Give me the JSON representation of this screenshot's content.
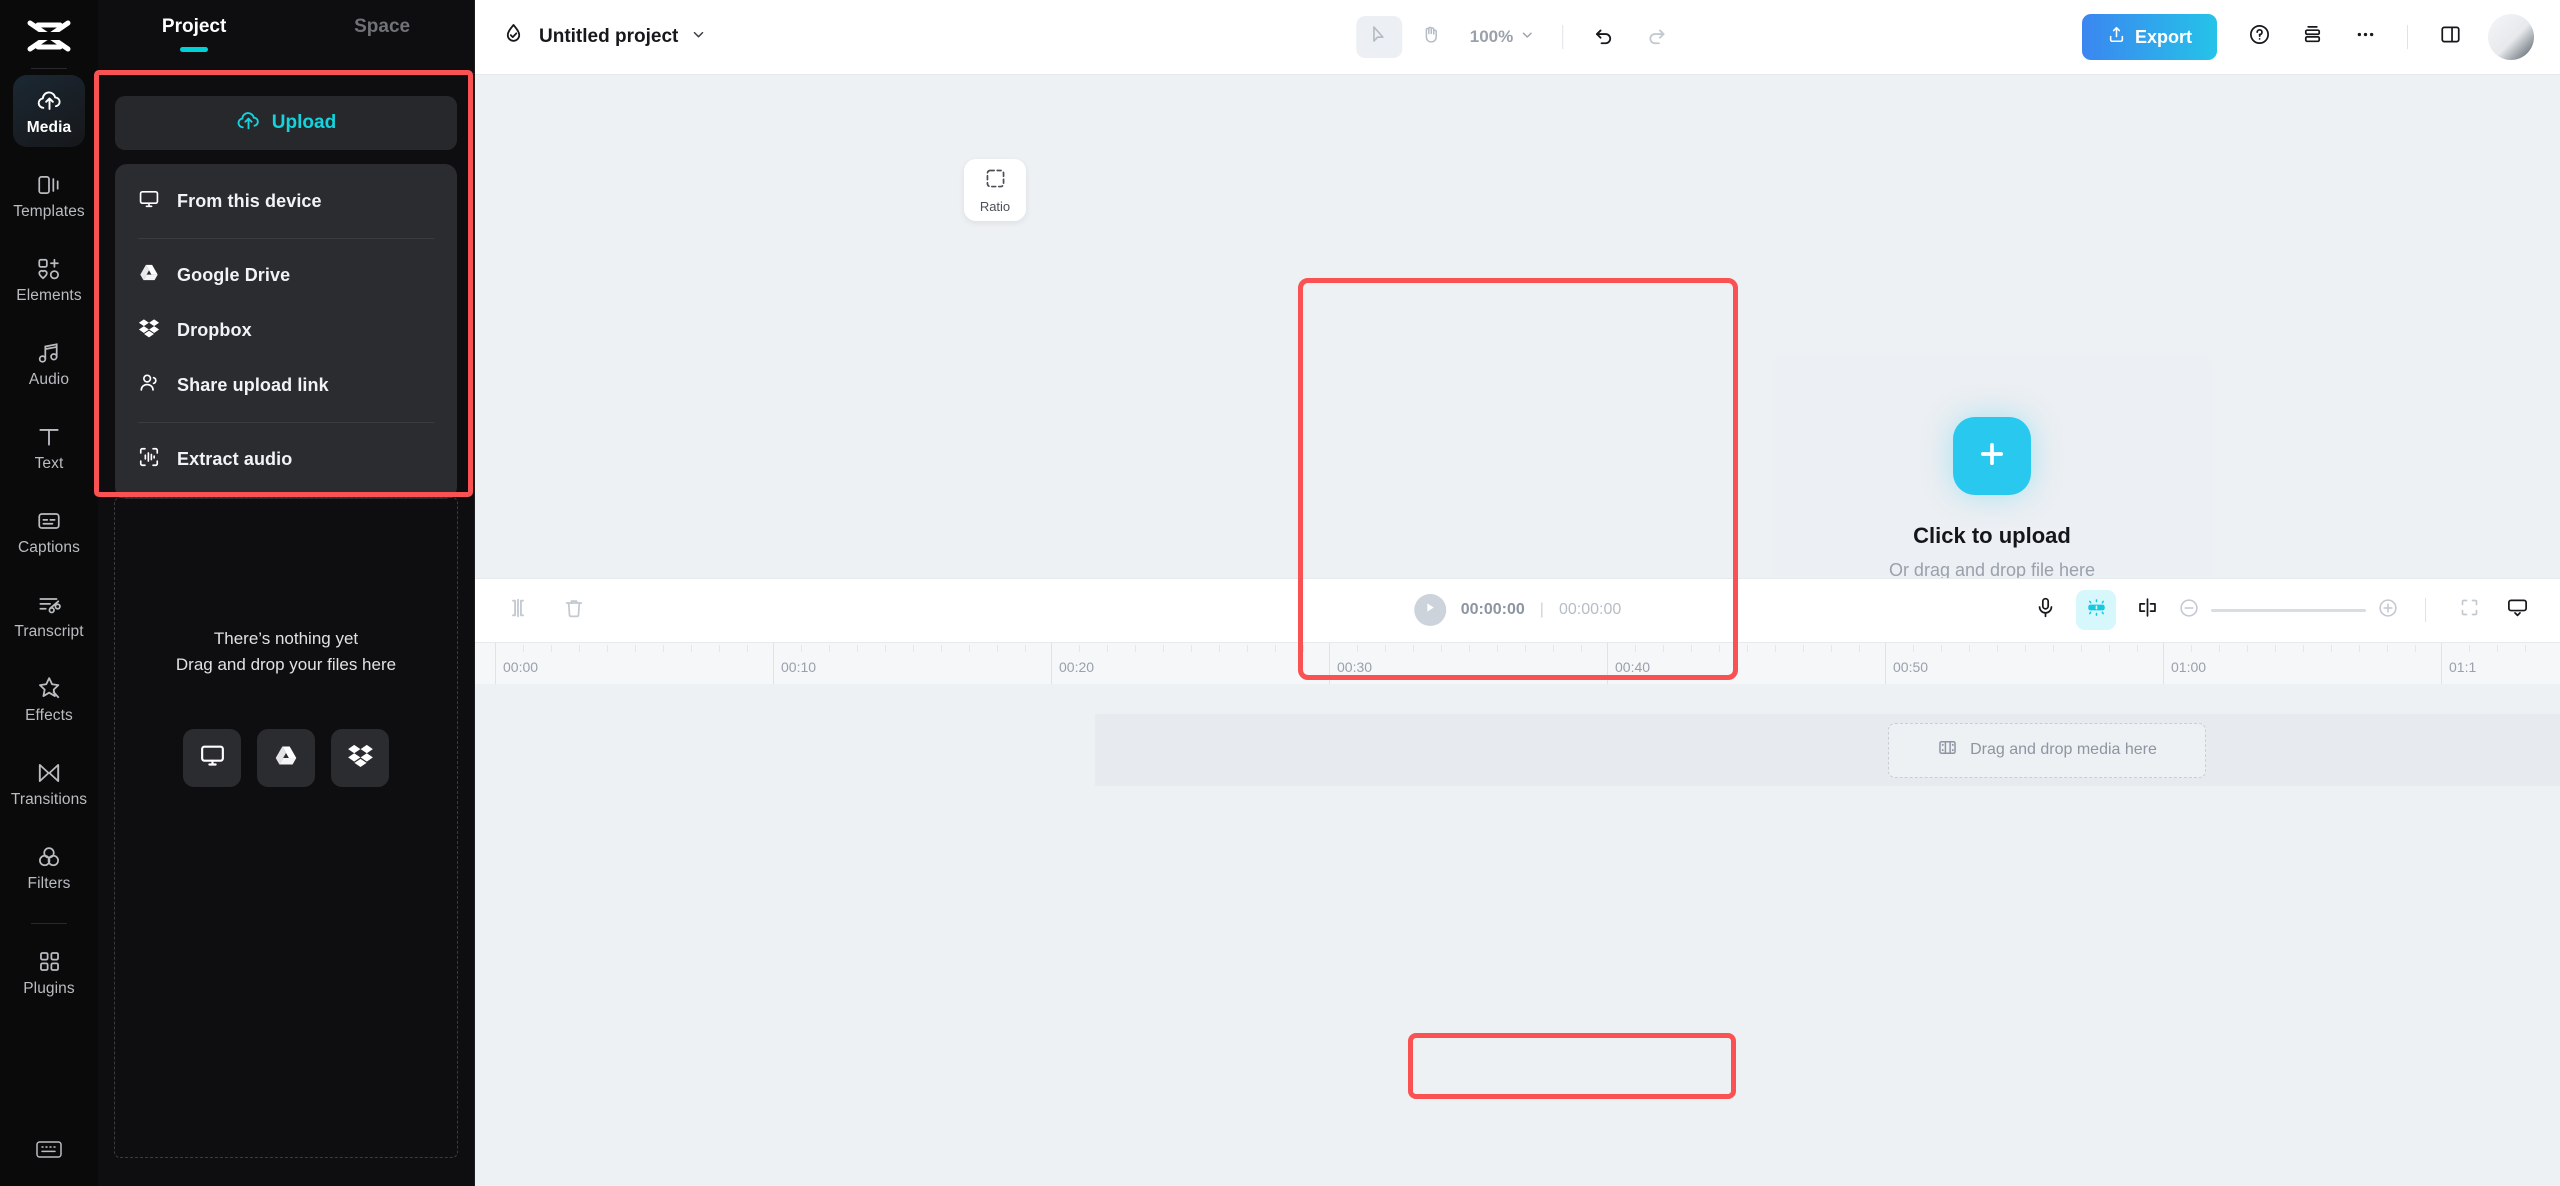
{
  "app": {
    "name": "CapCut",
    "logo_icon": "capcut-logo-icon"
  },
  "rail": {
    "items": [
      {
        "label": "Media",
        "icon": "cloud-upload-icon",
        "active": true
      },
      {
        "label": "Templates",
        "icon": "templates-icon",
        "active": false
      },
      {
        "label": "Elements",
        "icon": "elements-icon",
        "active": false
      },
      {
        "label": "Audio",
        "icon": "music-note-icon",
        "active": false
      },
      {
        "label": "Text",
        "icon": "text-t-icon",
        "active": false
      },
      {
        "label": "Captions",
        "icon": "captions-icon",
        "active": false
      },
      {
        "label": "Transcript",
        "icon": "transcript-icon",
        "active": false
      },
      {
        "label": "Effects",
        "icon": "sparkle-star-icon",
        "active": false
      },
      {
        "label": "Transitions",
        "icon": "transitions-icon",
        "active": false
      },
      {
        "label": "Filters",
        "icon": "filters-circles-icon",
        "active": false
      },
      {
        "label": "Plugins",
        "icon": "plugins-grid-icon",
        "active": false
      }
    ],
    "bottom_icon": "keyboard-shortcuts-icon"
  },
  "panel": {
    "tabs": [
      {
        "label": "Project",
        "active": true
      },
      {
        "label": "Space",
        "active": false
      }
    ],
    "upload_button": {
      "label": "Upload",
      "icon": "cloud-upload-icon",
      "color": "#13d4de"
    },
    "upload_menu": [
      {
        "label": "From this device",
        "icon": "monitor-icon"
      },
      {
        "label": "Google Drive",
        "icon": "google-drive-icon"
      },
      {
        "label": "Dropbox",
        "icon": "dropbox-icon"
      },
      {
        "label": "Share upload link",
        "icon": "people-icon"
      },
      {
        "label": "Extract audio",
        "icon": "extract-audio-icon"
      }
    ],
    "empty_state": {
      "line1": "There’s nothing yet",
      "line2": "Drag and drop your files here",
      "sources": [
        {
          "icon": "monitor-icon"
        },
        {
          "icon": "google-drive-icon"
        },
        {
          "icon": "dropbox-icon"
        }
      ]
    }
  },
  "topbar": {
    "project_icon": "capcut-check-cloud-icon",
    "project_name": "Untitled project",
    "project_caret": "chevron-down-icon",
    "tools": [
      {
        "name": "select-tool",
        "icon": "cursor-arrow-icon",
        "selected": true
      },
      {
        "name": "hand-tool",
        "icon": "hand-icon",
        "selected": false
      }
    ],
    "zoom_level": "100%",
    "undo_icon": "undo-arrow-icon",
    "redo_icon": "redo-arrow-icon",
    "export_label": "Export",
    "export_icon": "share-up-icon",
    "right_icons": [
      {
        "name": "help-button",
        "icon": "question-circle-icon"
      },
      {
        "name": "layers-button",
        "icon": "stack-layers-icon"
      },
      {
        "name": "more-options-button",
        "icon": "ellipsis-icon"
      },
      {
        "name": "layout-toggle",
        "icon": "panel-layout-icon"
      }
    ]
  },
  "stage": {
    "ratio_card": {
      "label": "Ratio",
      "icon": "dashed-square-icon"
    },
    "collapse_icon": "chevron-left-icon",
    "upload_area": {
      "plus_icon": "plus-icon",
      "title": "Click to upload",
      "subtitle": "Or drag and drop file here",
      "accent": "#29c9ef",
      "sources": [
        {
          "icon": "google-drive-icon"
        },
        {
          "icon": "dropbox-icon"
        }
      ]
    }
  },
  "timeline": {
    "left_tools": [
      {
        "name": "split-button",
        "icon": "split-clip-icon"
      },
      {
        "name": "delete-button",
        "icon": "trash-icon"
      }
    ],
    "play_icon": "play-triangle-icon",
    "current_time": "00:00:00",
    "time_divider": "|",
    "total_time": "00:00:00",
    "right_tools": [
      {
        "name": "record-voiceover-button",
        "icon": "microphone-icon",
        "active": false
      },
      {
        "name": "auto-enhance-button",
        "icon": "magic-bar-icon",
        "active": true
      },
      {
        "name": "mirror-button",
        "icon": "mirror-split-icon",
        "active": false
      }
    ],
    "zoom_out_icon": "minus-circle-icon",
    "zoom_in_icon": "plus-circle-icon",
    "fit_icon": "fit-screen-icon",
    "preview_icon": "monitor-caret-icon",
    "ruler_labels": [
      "00:00",
      "00:10",
      "00:20",
      "00:30",
      "00:40",
      "00:50",
      "01:00",
      "01:1"
    ],
    "dropzone": {
      "label": "Drag and drop media here",
      "icon": "film-strip-icon"
    }
  },
  "highlights": [
    {
      "name": "upload-menu-highlight"
    },
    {
      "name": "upload-area-highlight"
    },
    {
      "name": "timeline-dropzone-highlight"
    }
  ]
}
